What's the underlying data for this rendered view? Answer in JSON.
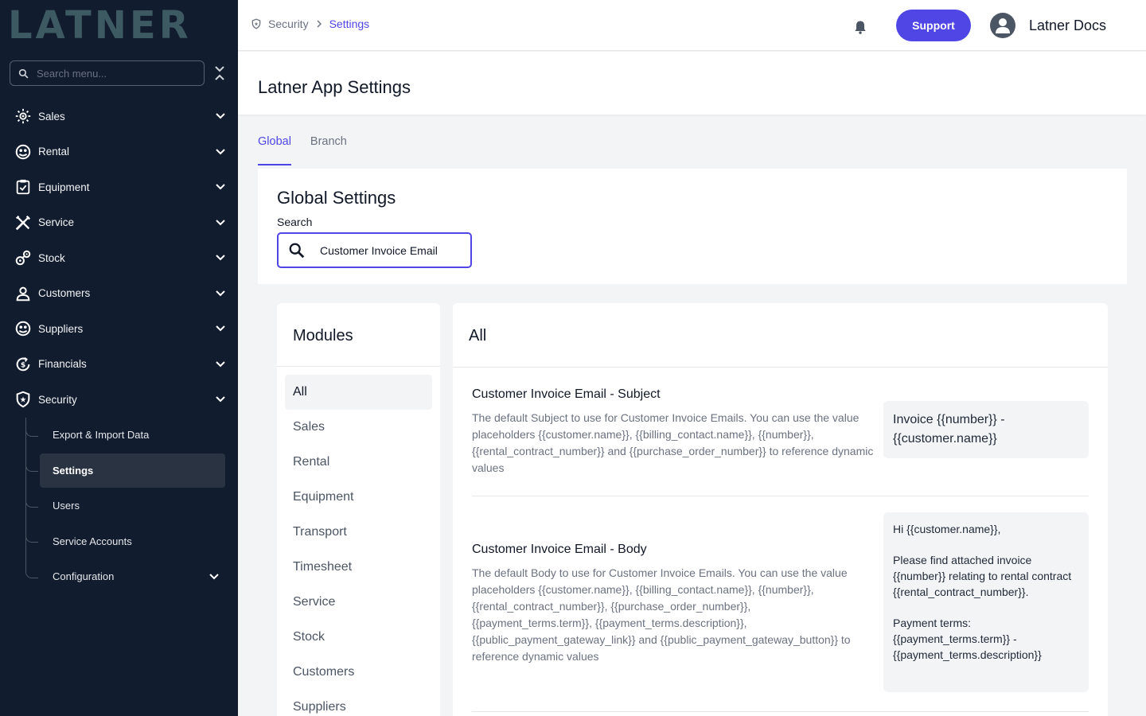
{
  "sidebar": {
    "logo_text": "LATNER",
    "search_placeholder": "Search menu...",
    "items": [
      {
        "label": "Sales",
        "icon": "sales-icon"
      },
      {
        "label": "Rental",
        "icon": "rental-icon"
      },
      {
        "label": "Equipment",
        "icon": "equipment-icon"
      },
      {
        "label": "Service",
        "icon": "service-icon"
      },
      {
        "label": "Stock",
        "icon": "stock-icon"
      },
      {
        "label": "Customers",
        "icon": "customers-icon"
      },
      {
        "label": "Suppliers",
        "icon": "suppliers-icon"
      },
      {
        "label": "Financials",
        "icon": "financials-icon"
      },
      {
        "label": "Security",
        "icon": "shield-icon"
      }
    ],
    "security_sub": [
      {
        "label": "Export & Import Data"
      },
      {
        "label": "Settings"
      },
      {
        "label": "Users"
      },
      {
        "label": "Service Accounts"
      },
      {
        "label": "Configuration"
      }
    ]
  },
  "header": {
    "breadcrumb": [
      "Security",
      "Settings"
    ],
    "support_label": "Support",
    "user_label": "Latner Docs"
  },
  "page": {
    "title": "Latner App Settings",
    "tabs": [
      "Global",
      "Branch"
    ],
    "active_tab": "Global"
  },
  "global_settings": {
    "title": "Global Settings",
    "search_label": "Search",
    "search_value": "Customer Invoice Email"
  },
  "modules": {
    "title": "Modules",
    "items": [
      "All",
      "Sales",
      "Rental",
      "Equipment",
      "Transport",
      "Timesheet",
      "Service",
      "Stock",
      "Customers",
      "Suppliers"
    ],
    "active": "All"
  },
  "settings_panel": {
    "title": "All",
    "settings": [
      {
        "name": "Customer Invoice Email - Subject",
        "description": "The default Subject to use for Customer Invoice Emails. You can use the value placeholders {{customer.name}}, {{billing_contact.name}}, {{number}}, {{rental_contract_number}} and {{purchase_order_number}} to reference dynamic values",
        "value": "Invoice {{number}} - {{customer.name}}"
      },
      {
        "name": "Customer Invoice Email - Body",
        "description": "The default Body to use for Customer Invoice Emails. You can use the value placeholders {{customer.name}}, {{billing_contact.name}}, {{number}}, {{rental_contract_number}}, {{purchase_order_number}}, {{payment_terms.term}}, {{payment_terms.description}}, {{public_payment_gateway_link}} and {{public_payment_gateway_button}} to reference dynamic values",
        "value": "Hi {{customer.name}},\n\nPlease find attached invoice {{number}} relating to rental contract {{rental_contract_number}}.\n\nPayment terms: {{payment_terms.term}} - {{payment_terms.description}}"
      }
    ]
  },
  "colors": {
    "sidebar_bg": "#111c2e",
    "accent": "#4f46e5",
    "logo": "#3d5a63"
  }
}
